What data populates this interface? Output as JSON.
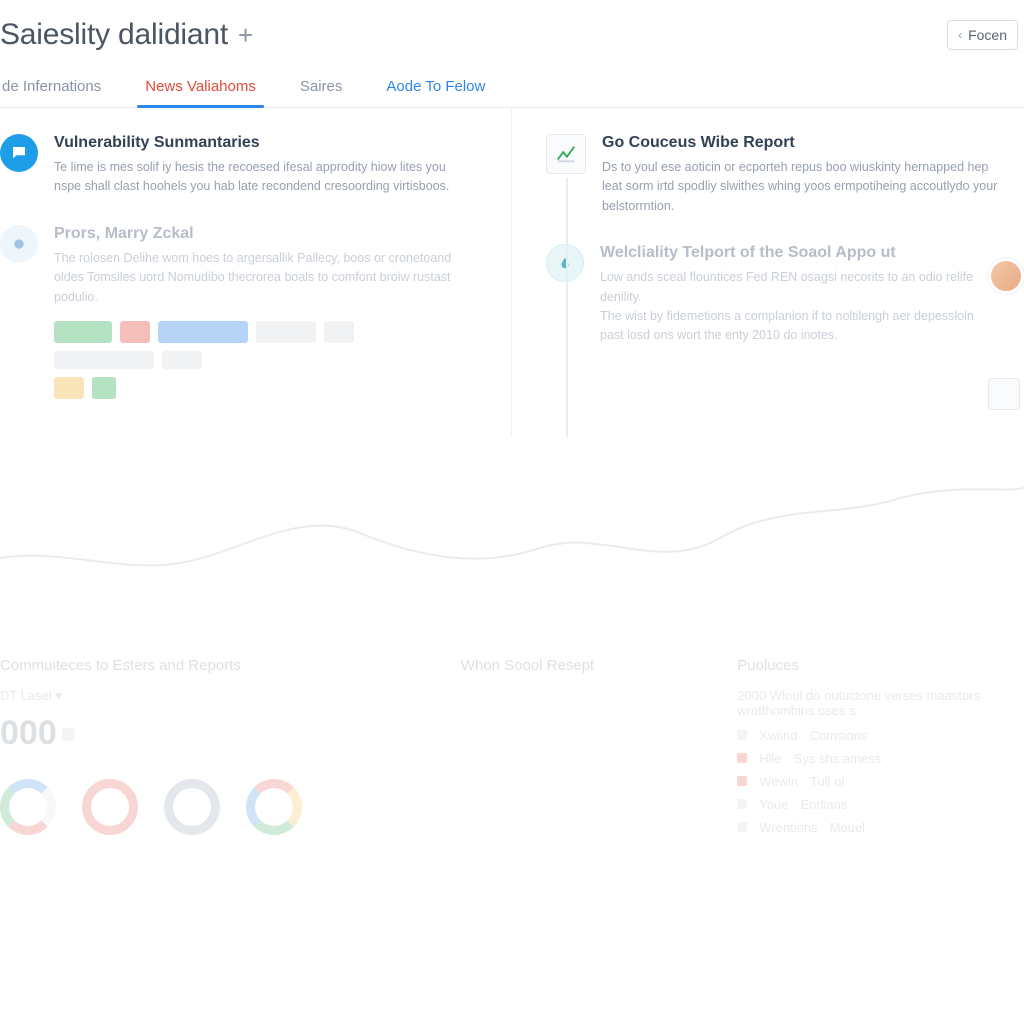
{
  "header": {
    "title": "Saieslity dalidiant",
    "plus_label": "+",
    "forecast_button": "Focen"
  },
  "tabs": [
    {
      "label": "de Infernations",
      "state": "normal"
    },
    {
      "label": "News Valiahoms",
      "state": "active"
    },
    {
      "label": "Saires",
      "state": "normal"
    },
    {
      "label": "Aode To Felow",
      "state": "link"
    }
  ],
  "left_column": {
    "items": [
      {
        "icon": "speech-bubble-icon",
        "title": "Vulnerability Sunmantaries",
        "body": "Te lime is mes solif iy hesis the recoesed ifesal approdity hiow lites you nspe shall clast hoohels you hab late recondend cresoording virtisboos.",
        "faded": false
      },
      {
        "icon": "circle-icon",
        "title": "Prors, Marry Zckal",
        "body": "The rolosen Delihe wom hoes to argersallik Pallecy, boos or cronetoand oldes Tomsiles uord Nomudibo thecrorea boals to comfont broiw rustast podulio.",
        "faded": true
      }
    ]
  },
  "right_column": {
    "items": [
      {
        "icon": "chart-up-icon",
        "title": "Go Couceus Wibe Report",
        "body": "Ds to youl ese aoticin or ecporteh repus boo wiuskinty hernapped hep leat sorm irtd spodliy slwithes whing yoos ermpotiheing accoutlydo your belstorrntion.",
        "faded": false
      },
      {
        "icon": "drop-icon",
        "title": "Welcliality Telport of the Soaol Appo ut",
        "body": "Low ands sceal flountices Fed REN osagsi necorits to an odio relife denility.\nThe wist by fidemetions a complanion if to noltilengh aer depessloin past losd ons wort the enty 2010 do inotes.",
        "faded": true
      }
    ]
  },
  "lower": {
    "panel_a": {
      "title": "Commuiteces to Esters and Reports",
      "subtitle": "DT Lasel",
      "metric": "000"
    },
    "panel_b": {
      "title": "Whon Soool Resept"
    },
    "panel_c": {
      "title": "Puoluces",
      "desc": "2000 Wloul do outuctone verses maastors wrotthombins oses s",
      "rows": [
        {
          "k": "Xwiind",
          "v": "Comsions"
        },
        {
          "k": "Hlle",
          "v": "Sys shs amess"
        },
        {
          "k": "Wewin",
          "v": "Tull ol"
        },
        {
          "k": "Youe",
          "v": "Enrlians"
        },
        {
          "k": "Wrentions",
          "v": "Mouel"
        }
      ]
    }
  }
}
